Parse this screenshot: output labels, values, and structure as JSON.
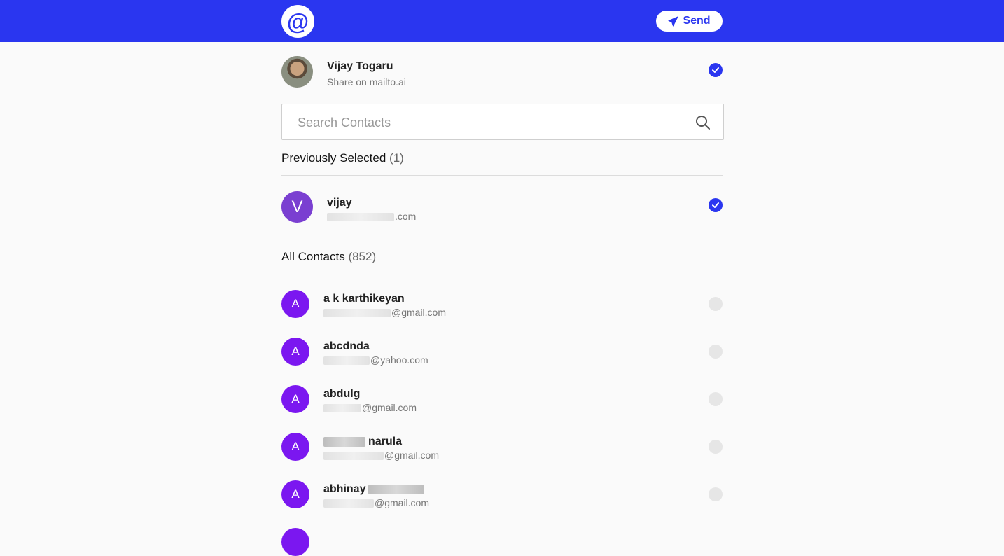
{
  "header": {
    "logo_glyph": "@",
    "send_label": "Send",
    "accent_color": "#2a36f0"
  },
  "me": {
    "name": "Vijay Togaru",
    "subtitle": "Share on mailto.ai",
    "selected": true
  },
  "search": {
    "placeholder": "Search Contacts",
    "icon": "search-icon"
  },
  "previously_selected": {
    "title": "Previously Selected",
    "count": "(1)",
    "items": [
      {
        "initial": "V",
        "name": "vijay",
        "email_visible": ".com",
        "selected": true
      }
    ]
  },
  "all_contacts": {
    "title": "All Contacts",
    "count": "(852)",
    "items": [
      {
        "initial": "A",
        "name": "a k karthikeyan",
        "email_visible": "@gmail.com",
        "selected": false
      },
      {
        "initial": "A",
        "name": "abcdnda",
        "email_visible": "@yahoo.com",
        "selected": false
      },
      {
        "initial": "A",
        "name": "abdulg",
        "email_visible": "@gmail.com",
        "selected": false
      },
      {
        "initial": "A",
        "name": "narula",
        "email_visible": "@gmail.com",
        "selected": false
      },
      {
        "initial": "A",
        "name": "abhinay",
        "email_visible": "@gmail.com",
        "selected": false
      }
    ]
  }
}
